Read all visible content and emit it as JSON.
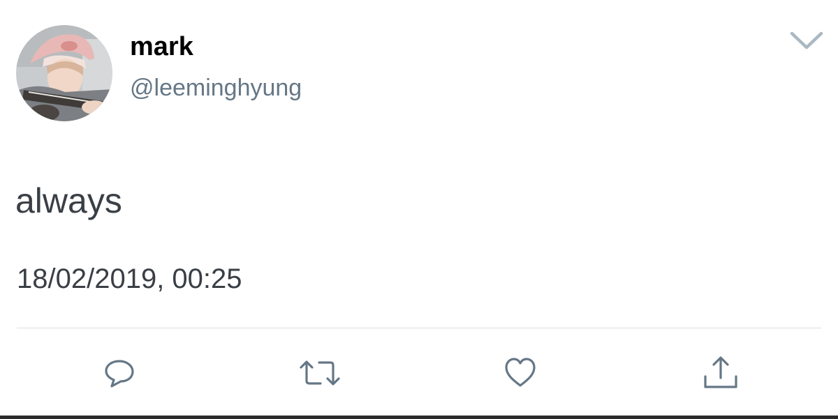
{
  "tweet": {
    "display_name": "mark",
    "handle": "@leeminghyung",
    "text": "always",
    "timestamp": "18/02/2019, 00:25"
  },
  "icons": {
    "menu": "chevron-down-icon",
    "reply": "reply-icon",
    "retweet": "retweet-icon",
    "like": "heart-icon",
    "share": "share-icon"
  },
  "colors": {
    "name": "#000000",
    "handle": "#657786",
    "text": "#3a3f45",
    "icon": "#657786",
    "divider": "#d9dde1"
  }
}
